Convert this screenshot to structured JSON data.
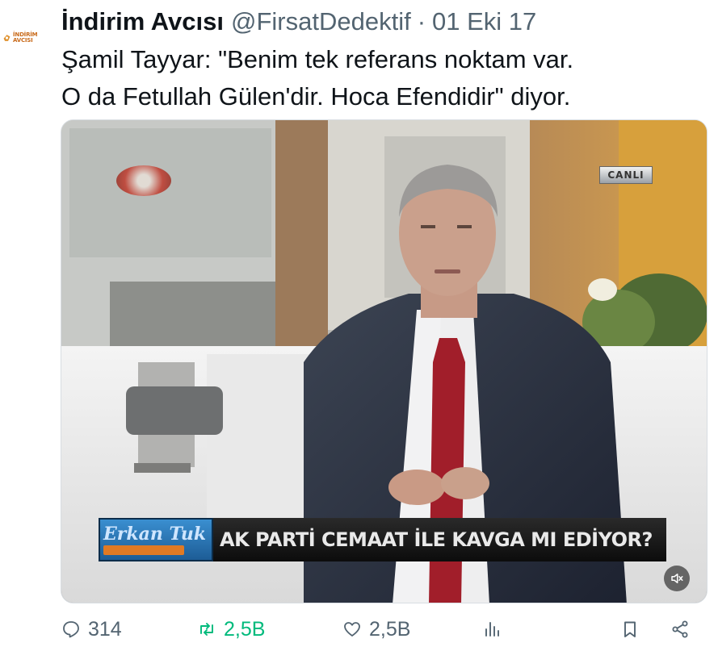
{
  "author": {
    "avatar_logo_text": "İNDİRİM AVCISI",
    "name": "İndirim Avcısı",
    "handle": "@FirsatDedektif",
    "separator": "·",
    "date": "01 Eki 17"
  },
  "tweet": {
    "text_line_1": "Şamil Tayyar: \"Benim tek referans noktam var.",
    "text_line_2": "O da Fetullah Gülen'dir. Hoca Efendidir\" diyor."
  },
  "media": {
    "live_badge": "CANLI",
    "show_name": "Erkan Tuk",
    "headline": "AK PARTİ CEMAAT İLE KAVGA MI EDİYOR?",
    "mute_icon": "speaker-muted-icon"
  },
  "actions": {
    "reply": {
      "icon": "reply-icon",
      "count": "314"
    },
    "retweet": {
      "icon": "retweet-icon",
      "count": "2,5B",
      "color": "#00ba7c"
    },
    "like": {
      "icon": "heart-icon",
      "count": "2,5B"
    },
    "views": {
      "icon": "views-icon"
    },
    "bookmark": {
      "icon": "bookmark-icon"
    },
    "share": {
      "icon": "share-icon"
    }
  },
  "colors": {
    "text_primary": "#0f1419",
    "text_secondary": "#536471",
    "retweet_active": "#00ba7c",
    "logo_orange": "#c96b1b"
  }
}
